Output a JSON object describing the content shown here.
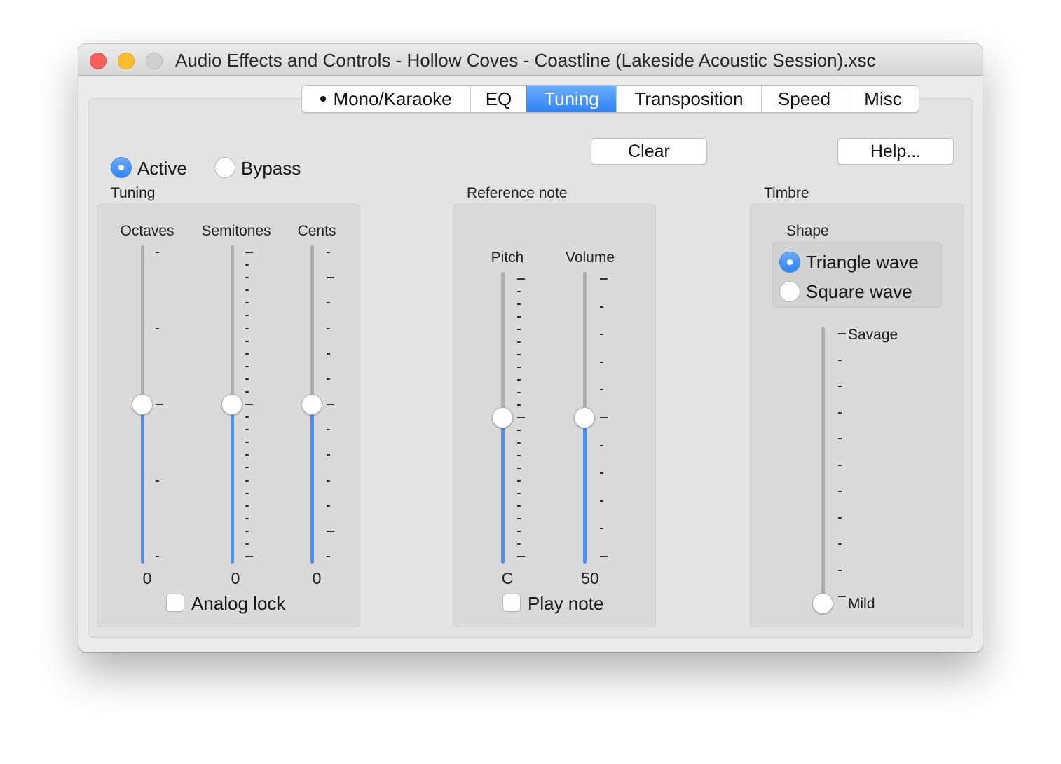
{
  "window": {
    "title": "Audio Effects and Controls - Hollow Coves - Coastline (Lakeside Acoustic Session).xsc"
  },
  "tabs": [
    {
      "label": "Mono/Karaoke",
      "selected": false,
      "dot": true
    },
    {
      "label": "EQ",
      "selected": false
    },
    {
      "label": "Tuning",
      "selected": true
    },
    {
      "label": "Transposition",
      "selected": false
    },
    {
      "label": "Speed",
      "selected": false
    },
    {
      "label": "Misc",
      "selected": false
    }
  ],
  "buttons": {
    "clear": "Clear",
    "help": "Help..."
  },
  "mode": {
    "active": "Active",
    "bypass": "Bypass",
    "selected": "Active"
  },
  "tuning": {
    "section": "Tuning",
    "octaves": {
      "label": "Octaves",
      "value": "0",
      "level": 0.5
    },
    "semitones": {
      "label": "Semitones",
      "value": "0",
      "level": 0.5
    },
    "cents": {
      "label": "Cents",
      "value": "0",
      "level": 0.5
    },
    "analog_lock": {
      "label": "Analog lock",
      "checked": false
    }
  },
  "reference": {
    "section": "Reference note",
    "pitch": {
      "label": "Pitch",
      "value": "C",
      "level": 0.5
    },
    "volume": {
      "label": "Volume",
      "value": "50",
      "level": 0.5
    },
    "play_note": {
      "label": "Play note",
      "checked": false
    }
  },
  "timbre": {
    "section": "Timbre",
    "shape": {
      "label": "Shape",
      "options": [
        "Triangle wave",
        "Square wave"
      ],
      "selected": "Triangle wave"
    },
    "slider": {
      "max_label": "Savage",
      "min_label": "Mild",
      "level": 0
    }
  },
  "colors": {
    "accent": "#2f83f5",
    "slider_fill": "#4a90f5"
  }
}
